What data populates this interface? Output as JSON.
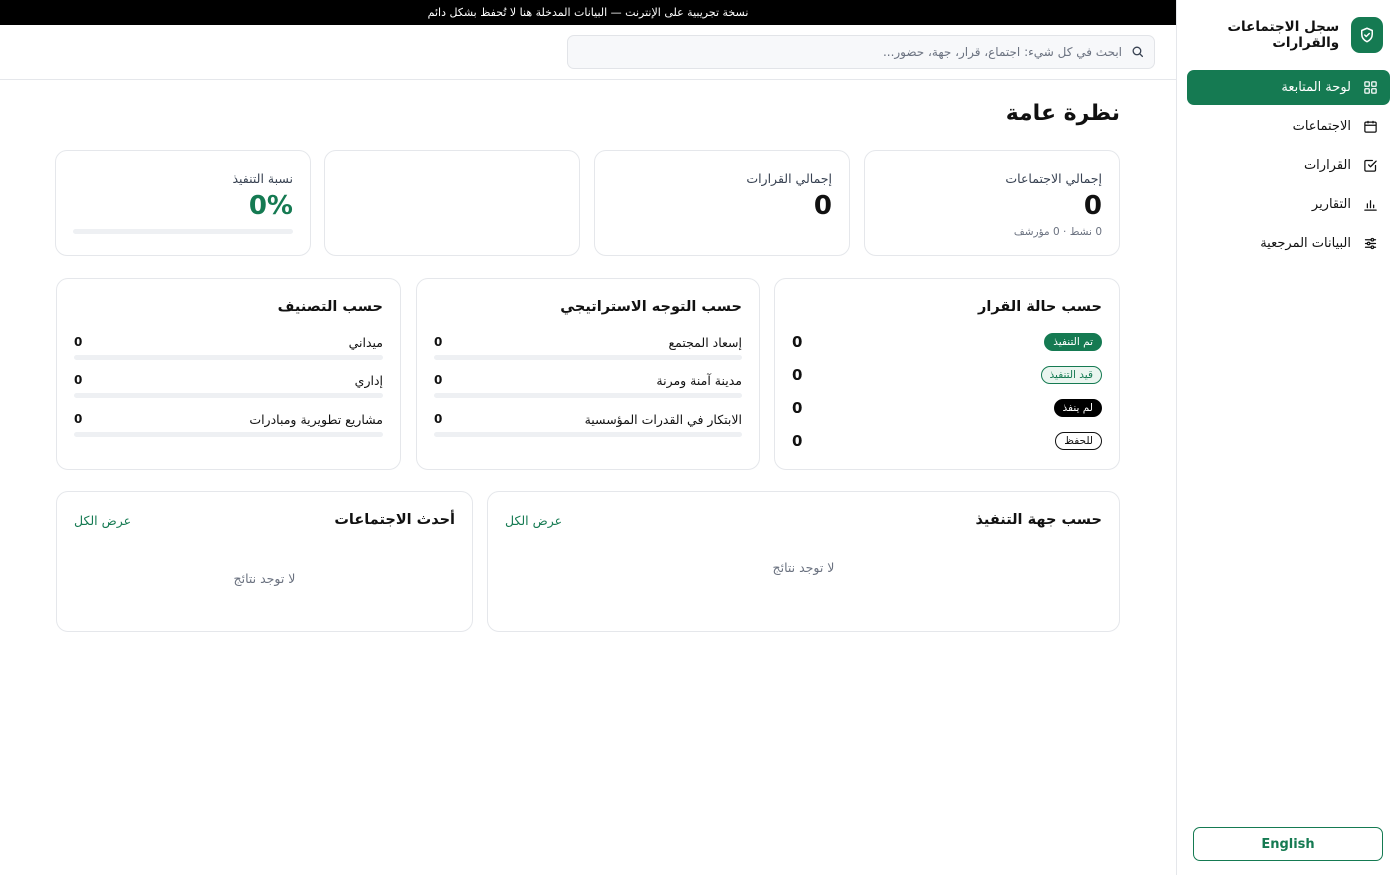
{
  "banner": {
    "text": "نسخة تجريبية على الإنترنت — البيانات المدخلة هنا لا تُحفظ بشكل دائم"
  },
  "brand": {
    "title": "سجل الاجتماعات والقرارات",
    "icon": "shield-check-icon"
  },
  "sidebar": {
    "items": [
      {
        "label": "لوحة المتابعة",
        "icon": "dashboard-icon",
        "active": true
      },
      {
        "label": "الاجتماعات",
        "icon": "calendar-icon"
      },
      {
        "label": "القرارات",
        "icon": "checkbox-icon"
      },
      {
        "label": "التقارير",
        "icon": "bar-chart-icon"
      },
      {
        "label": "البيانات المرجعية",
        "icon": "sliders-icon"
      }
    ],
    "language_button": "English"
  },
  "search": {
    "placeholder": "ابحث في كل شيء: اجتماع، قرار، جهة، حضور..."
  },
  "page": {
    "title": "نظرة عامة"
  },
  "stats": {
    "meetings": {
      "label": "إجمالي الاجتماعات",
      "value": "0",
      "sub": "0 نشط · 0 مؤرشف"
    },
    "decisions": {
      "label": "إجمالي القرارات",
      "value": "0"
    },
    "execution": {
      "label": "نسبة التنفيذ",
      "value": "0%",
      "progress": 0
    }
  },
  "by_status": {
    "title": "حسب حالة القرار",
    "rows": [
      {
        "label": "تم التنفيذ",
        "count": "0"
      },
      {
        "label": "قيد التنفيذ",
        "count": "0"
      },
      {
        "label": "لم ينفذ",
        "count": "0"
      },
      {
        "label": "للحفظ",
        "count": "0"
      }
    ]
  },
  "by_direction": {
    "title": "حسب التوجه الاستراتيجي",
    "rows": [
      {
        "label": "إسعاد المجتمع",
        "value": "0",
        "fill": 0
      },
      {
        "label": "مدينة آمنة ومرنة",
        "value": "0",
        "fill": 0
      },
      {
        "label": "الابتكار في القدرات المؤسسية",
        "value": "0",
        "fill": 0
      }
    ]
  },
  "by_category": {
    "title": "حسب التصنيف",
    "rows": [
      {
        "label": "ميداني",
        "value": "0",
        "fill": 0
      },
      {
        "label": "إداري",
        "value": "0",
        "fill": 0
      },
      {
        "label": "مشاريع تطويرية ومبادرات",
        "value": "0",
        "fill": 0
      }
    ]
  },
  "by_entity": {
    "title": "حسب جهة التنفيذ",
    "view_all": "عرض الكل",
    "empty": "لا توجد نتائج"
  },
  "latest_meetings": {
    "title": "أحدث الاجتماعات",
    "view_all": "عرض الكل",
    "empty": "لا توجد نتائج"
  },
  "colors": {
    "primary": "#157a52",
    "border": "#e5e7eb",
    "track": "#eef0f3"
  }
}
